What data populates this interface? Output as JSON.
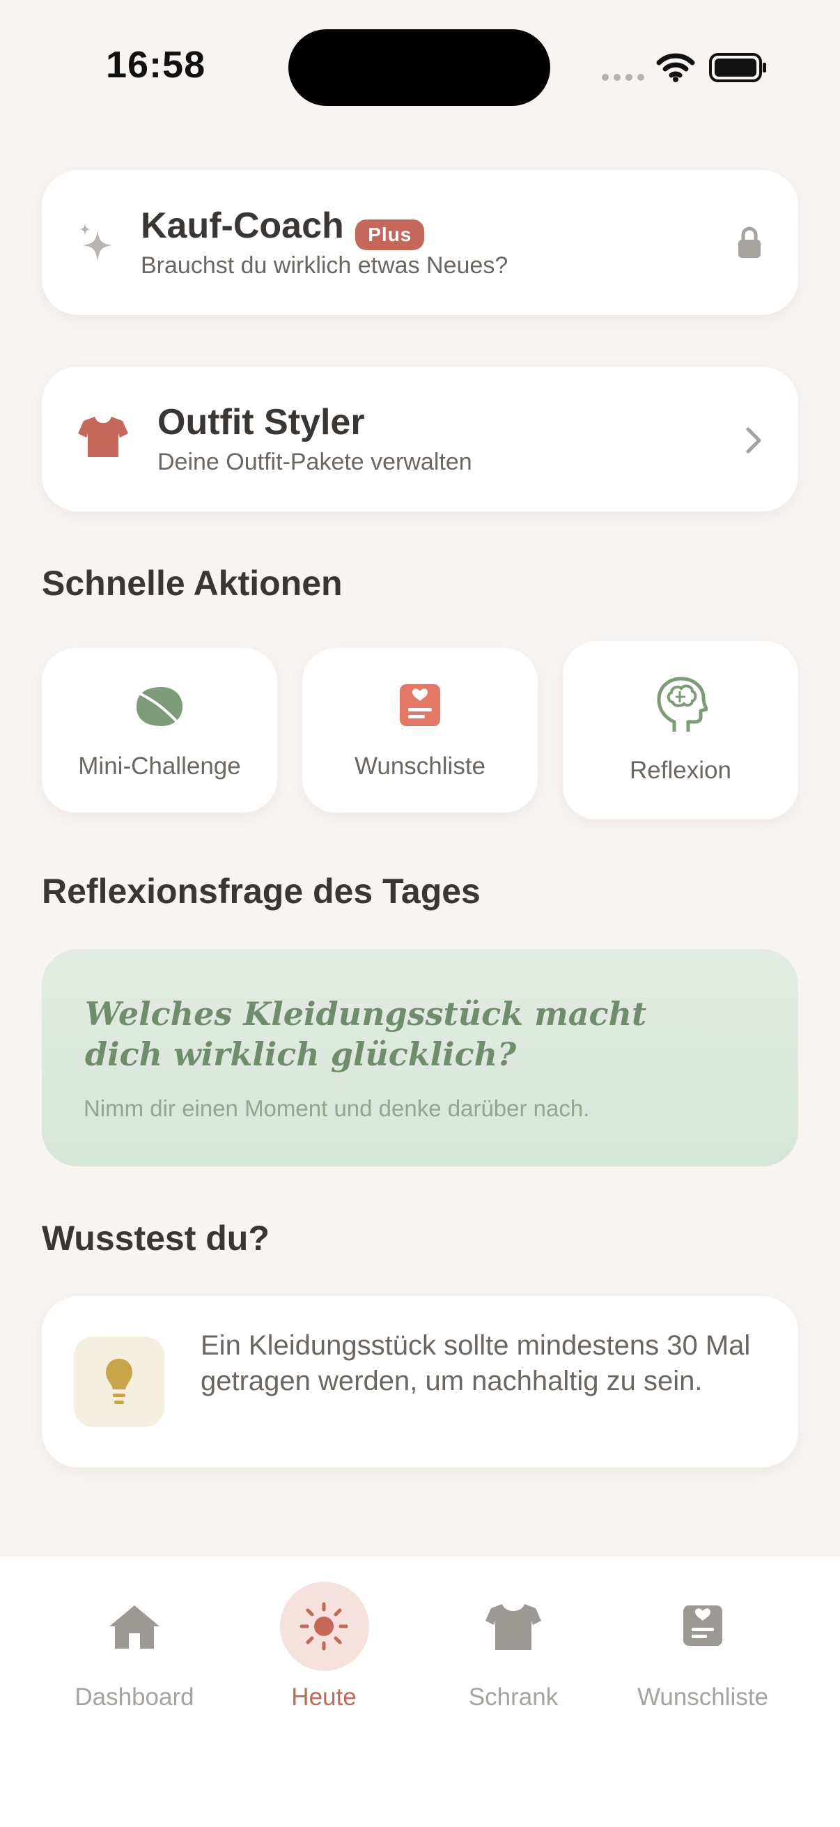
{
  "status_bar": {
    "time": "16:58"
  },
  "kauf_coach": {
    "title": "Kauf-Coach",
    "badge": "Plus",
    "subtitle": "Brauchst du wirklich etwas Neues?"
  },
  "outfit_styler": {
    "title": "Outfit Styler",
    "subtitle": "Deine Outfit-Pakete verwalten"
  },
  "quick_actions": {
    "title": "Schnelle Aktionen",
    "items": [
      {
        "label": "Mini-Challenge",
        "icon": "leaf-icon"
      },
      {
        "label": "Wunschliste",
        "icon": "wishlist-icon"
      },
      {
        "label": "Reflexion",
        "icon": "brain-head-icon"
      }
    ]
  },
  "reflection": {
    "title": "Reflexionsfrage des Tages",
    "question": "Welches Kleidungsstück macht dich wirklich glücklich?",
    "hint": "Nimm dir einen Moment und denke darüber nach."
  },
  "did_you_know": {
    "title": "Wusstest du?",
    "text": "Ein Kleidungsstück sollte mindestens 30 Mal getragen werden, um nachhaltig zu sein."
  },
  "tabbar": {
    "items": [
      {
        "label": "Dashboard",
        "icon": "home-icon",
        "active": false
      },
      {
        "label": "Heute",
        "icon": "sun-icon",
        "active": true
      },
      {
        "label": "Schrank",
        "icon": "shirt-icon",
        "active": false
      },
      {
        "label": "Wunschliste",
        "icon": "wishlist-icon",
        "active": false
      }
    ]
  },
  "colors": {
    "background": "#f8f4f1",
    "accent": "#c5685a",
    "green_card": "#dfe9df",
    "green_text": "#6e8d6a",
    "tip_icon": "#c7a548"
  }
}
